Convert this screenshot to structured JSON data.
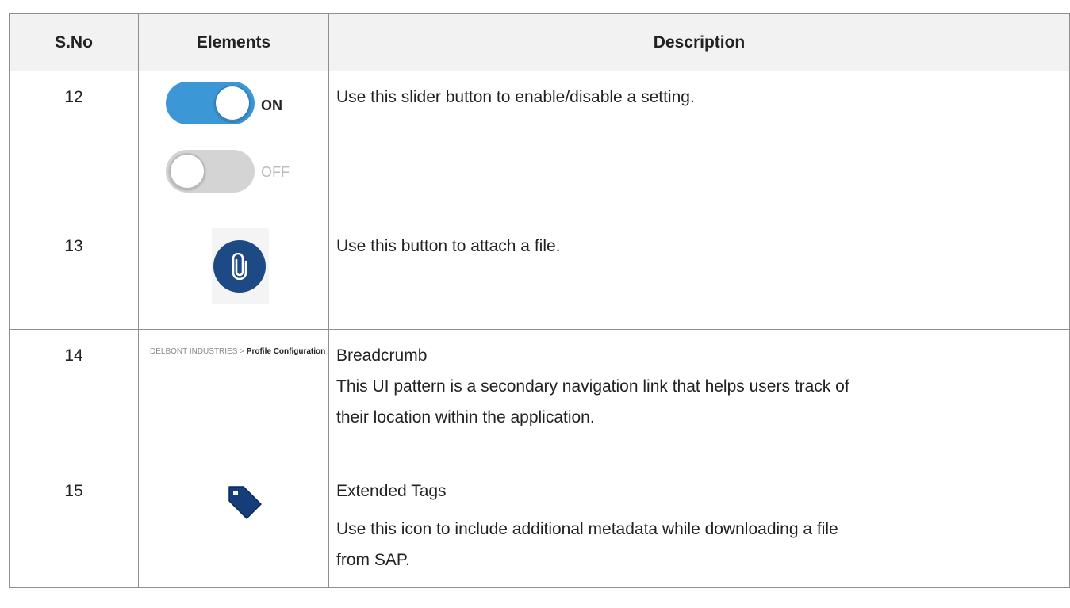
{
  "table": {
    "headers": {
      "sno": "S.No",
      "elements": "Elements",
      "description": "Description"
    },
    "rows": [
      {
        "sno": "12",
        "toggle_on_label": "ON",
        "toggle_off_label": "OFF",
        "description_lines": [
          "Use this slider button to enable/disable a setting."
        ]
      },
      {
        "sno": "13",
        "icon": "paperclip-icon",
        "description_lines": [
          "Use this button to attach a file."
        ]
      },
      {
        "sno": "14",
        "breadcrumb": {
          "root": "DELBONT INDUSTRIES",
          "separator": ">",
          "current": "Profile Configuration"
        },
        "description_lines": [
          "Breadcrumb",
          "This UI pattern is a secondary navigation link that helps users track of",
          "their location within the application."
        ]
      },
      {
        "sno": "15",
        "icon": "tag-icon",
        "description_lines": [
          "Extended Tags",
          "Use this icon to include additional metadata while downloading a file",
          "from SAP."
        ]
      }
    ]
  },
  "colors": {
    "toggle_on": "#3b97d6",
    "toggle_off": "#d4d4d4",
    "attach_button": "#1d4a84",
    "tag": "#143d7a",
    "border": "#8f8f8f",
    "header_bg": "#f2f2f2"
  }
}
